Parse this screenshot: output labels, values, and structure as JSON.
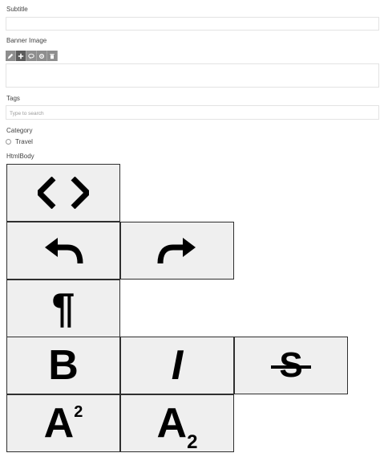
{
  "form": {
    "subtitle_label": "Subtitle",
    "subtitle_value": "",
    "banner_label": "Banner Image",
    "tags_label": "Tags",
    "tags_placeholder": "Type to search",
    "category_label": "Category",
    "category_option": "Travel",
    "htmlbody_label": "HtmlBody"
  },
  "banner_toolbar": {
    "buttons": [
      "pencil-icon",
      "plus-icon",
      "comment-icon",
      "gear-icon",
      "trash-icon"
    ],
    "active_index": 1
  },
  "editor_toolbar": {
    "buttons": [
      {
        "name": "code-view",
        "icon": "code-icon"
      },
      {
        "name": "undo",
        "icon": "undo-icon"
      },
      {
        "name": "redo",
        "icon": "redo-icon"
      },
      {
        "name": "paragraph",
        "icon": "pilcrow-icon",
        "text": "¶"
      },
      {
        "name": "bold",
        "icon": "bold-icon",
        "text": "B"
      },
      {
        "name": "italic",
        "icon": "italic-icon",
        "text": "I"
      },
      {
        "name": "strikethrough",
        "icon": "strikethrough-icon",
        "text": "S"
      },
      {
        "name": "superscript",
        "icon": "superscript-icon",
        "text": "A",
        "sup": "2"
      },
      {
        "name": "subscript",
        "icon": "subscript-icon",
        "text": "A",
        "sub": "2"
      }
    ]
  },
  "colors": {
    "button_bg": "#efefef",
    "button_border": "#2f2f2f",
    "toolbar_bg": "#8e8e8e",
    "toolbar_active": "#5c5c5c"
  }
}
